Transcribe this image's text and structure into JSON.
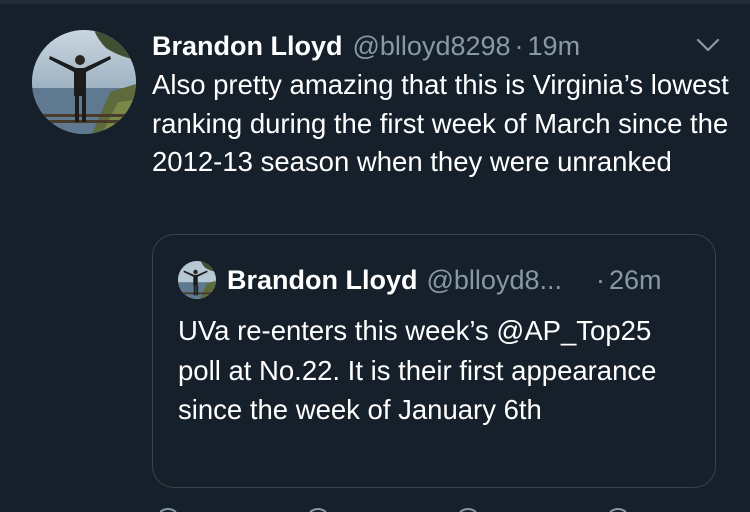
{
  "tweet": {
    "author_name": "Brandon Lloyd",
    "handle": "@blloyd8298",
    "separator": "·",
    "time": "19m",
    "text": "Also pretty amazing that this is Virginia’s lowest ranking during the first week of March since the 2012-13 season when they were unranked",
    "avatar_icon": "profile-photo-icon",
    "menu_icon": "chevron-down-icon"
  },
  "quoted_tweet": {
    "author_name": "Brandon Lloyd",
    "handle": "@blloyd8...",
    "separator": "·",
    "time": "26m",
    "text": "UVa re-enters this week’s @AP_Top25 poll at No.22. It is their first appearance since the week of January 6th",
    "avatar_icon": "profile-photo-icon"
  },
  "colors": {
    "background": "#15202b",
    "primary_text": "#ffffff",
    "secondary_text": "#8899a6",
    "border": "#38444d"
  }
}
